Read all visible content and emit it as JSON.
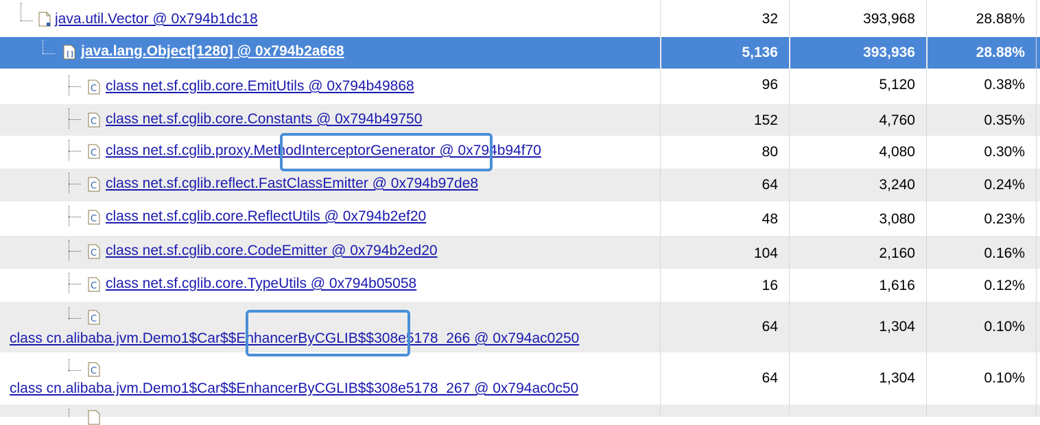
{
  "rows": [
    {
      "name": "java.util.Vector @ 0x794b1dc18",
      "shallow": "32",
      "retained": "393,968",
      "percent": "28.88%",
      "icon": "object-icon"
    },
    {
      "name": "java.lang.Object[1280] @ 0x794b2a668",
      "shallow": "5,136",
      "retained": "393,936",
      "percent": "28.88%",
      "icon": "array-icon"
    },
    {
      "name": "class net.sf.cglib.core.EmitUtils @ 0x794b49868",
      "shallow": "96",
      "retained": "5,120",
      "percent": "0.38%",
      "icon": "class-icon"
    },
    {
      "name": "class net.sf.cglib.core.Constants @ 0x794b49750",
      "shallow": "152",
      "retained": "4,760",
      "percent": "0.35%",
      "icon": "class-icon"
    },
    {
      "name": "class net.sf.cglib.proxy.MethodInterceptorGenerator @ 0x794b94f70",
      "shallow": "80",
      "retained": "4,080",
      "percent": "0.30%",
      "icon": "class-icon"
    },
    {
      "name": "class net.sf.cglib.reflect.FastClassEmitter @ 0x794b97de8",
      "shallow": "64",
      "retained": "3,240",
      "percent": "0.24%",
      "icon": "class-icon"
    },
    {
      "name": "class net.sf.cglib.core.ReflectUtils @ 0x794b2ef20",
      "shallow": "48",
      "retained": "3,080",
      "percent": "0.23%",
      "icon": "class-icon"
    },
    {
      "name": "class net.sf.cglib.core.CodeEmitter @ 0x794b2ed20",
      "shallow": "104",
      "retained": "2,160",
      "percent": "0.16%",
      "icon": "class-icon"
    },
    {
      "name": "class net.sf.cglib.core.TypeUtils @ 0x794b05058",
      "shallow": "16",
      "retained": "1,616",
      "percent": "0.12%",
      "icon": "class-icon"
    },
    {
      "name": "class cn.alibaba.jvm.Demo1$Car$$EnhancerByCGLIB$$308e5178_266 @ 0x794ac0250",
      "shallow": "64",
      "retained": "1,304",
      "percent": "0.10%",
      "icon": "class-icon"
    },
    {
      "name": "class cn.alibaba.jvm.Demo1$Car$$EnhancerByCGLIB$$308e5178_267 @ 0x794ac0c50",
      "shallow": "64",
      "retained": "1,304",
      "percent": "0.10%",
      "icon": "class-icon"
    }
  ],
  "colors": {
    "selection": "#4a86d6",
    "link": "#1a1ab0",
    "highlight_box": "#4a8fd8",
    "stripe": "#ececec"
  }
}
